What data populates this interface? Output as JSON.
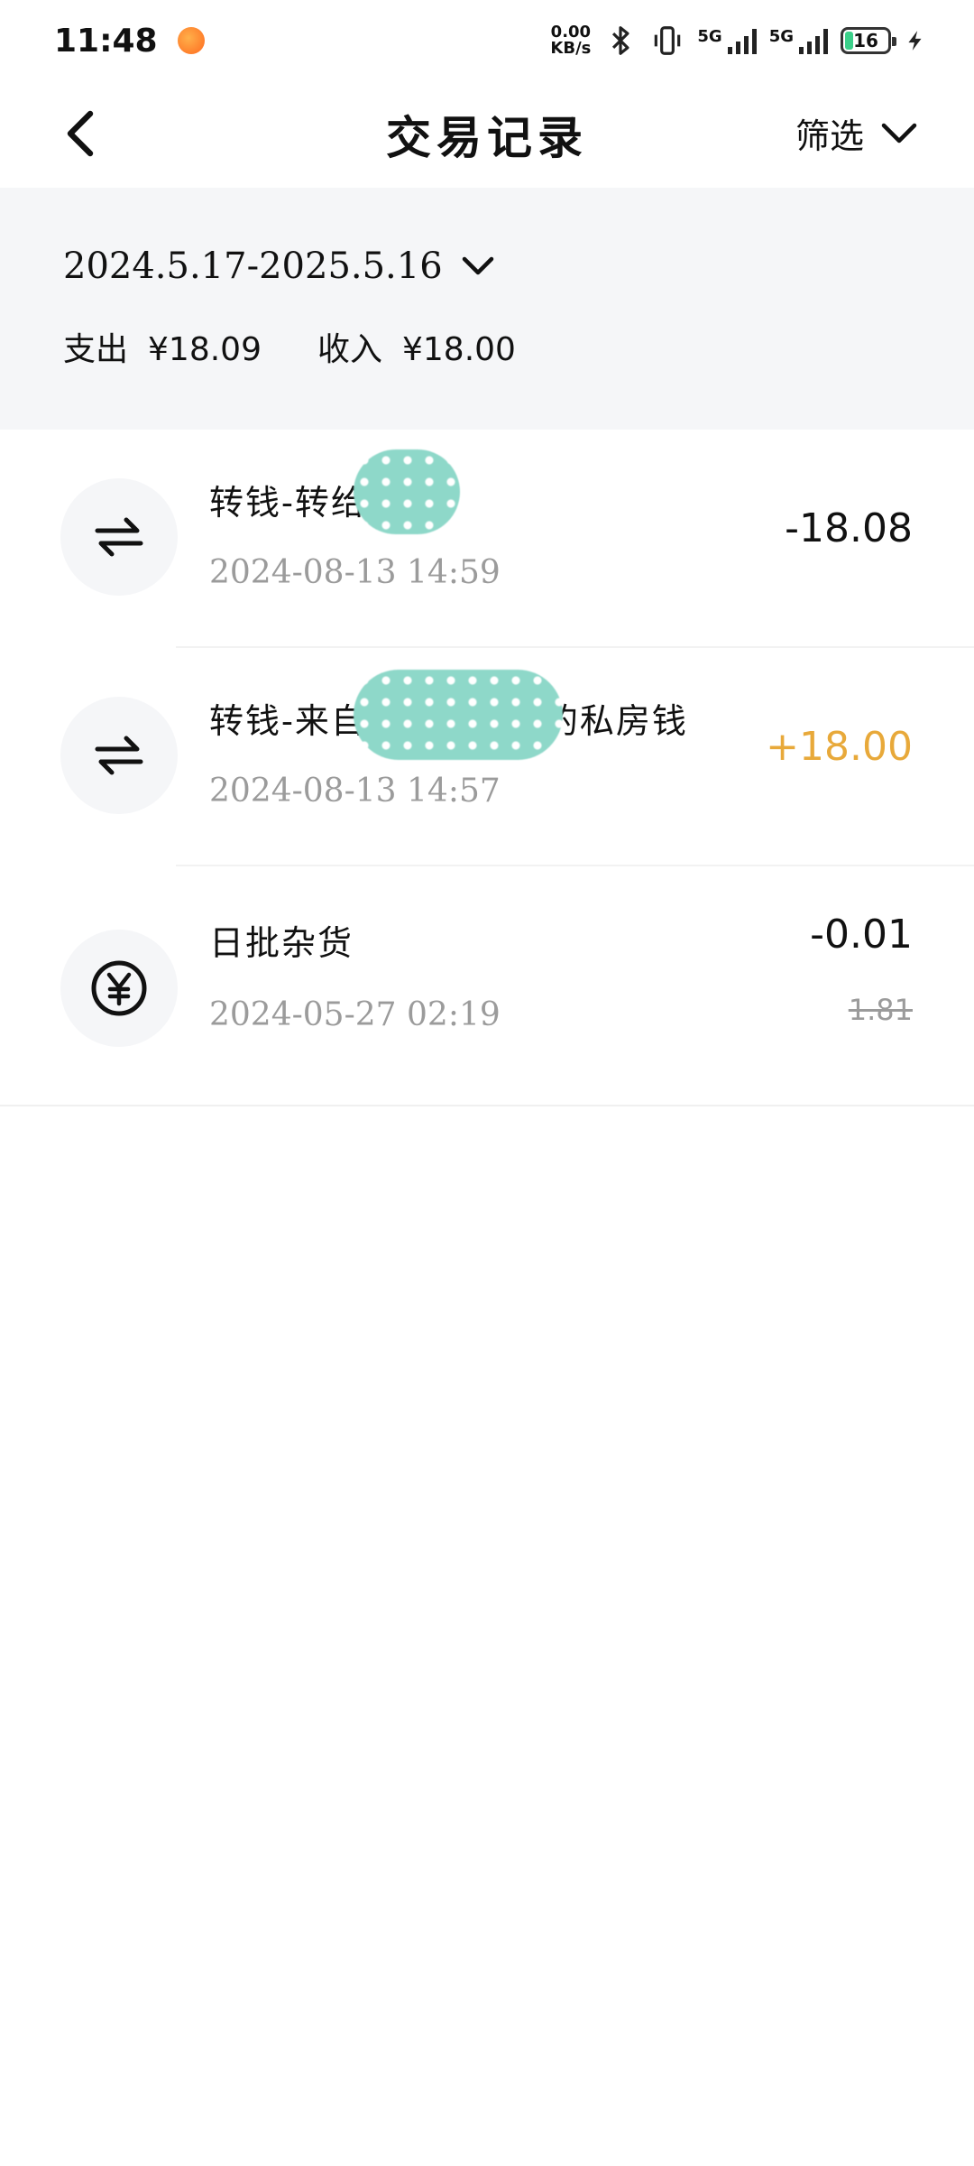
{
  "status_bar": {
    "time": "11:48",
    "speed_value": "0.00",
    "speed_unit": "KB/s",
    "net1": "5G",
    "net2": "5G",
    "battery": "16"
  },
  "header": {
    "title": "交易记录",
    "filter_label": "筛选"
  },
  "summary": {
    "date_range": "2024.5.17-2025.5.16",
    "expense_label": "支出",
    "expense_value": "¥18.09",
    "income_label": "收入",
    "income_value": "¥18.00"
  },
  "transactions": [
    {
      "title": "转钱-转给",
      "title_suffix": "",
      "time": "2024-08-13 14:59",
      "amount": "-18.08",
      "icon": "transfer-icon",
      "type": "expense"
    },
    {
      "title": "转钱-来自",
      "title_suffix": "的私房钱",
      "time": "2024-08-13 14:57",
      "amount": "+18.00",
      "icon": "transfer-icon",
      "type": "income"
    },
    {
      "title": "日批杂货",
      "time": "2024-05-27 02:19",
      "amount": "-0.01",
      "original_amount": "1.81",
      "icon": "yuan-coin-icon",
      "type": "expense"
    }
  ],
  "colors": {
    "income": "#e8a93a",
    "muted": "#9b9b9b",
    "summary_bg": "#f5f6f8"
  }
}
